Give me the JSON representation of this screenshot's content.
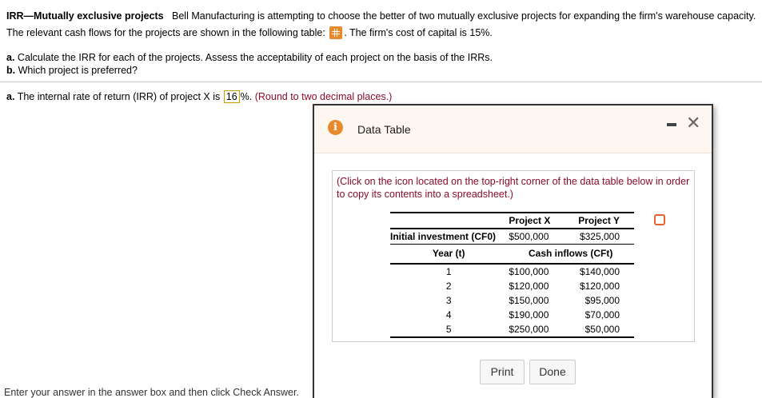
{
  "question": {
    "title": "IRR—Mutually exclusive projects",
    "text1": "Bell Manufacturing is attempting to choose the better of two mutually exclusive projects for expanding the firm's warehouse capacity. The relevant cash flows for the projects are shown in the following table:",
    "text2": ". The firm's cost of capital is 15%.",
    "part_a_label": "a.",
    "part_a": "Calculate the IRR for each of the projects. Assess the acceptability of each project on the basis of the IRRs.",
    "part_b_label": "b.",
    "part_b": "Which project is preferred?"
  },
  "answer": {
    "label": "a.",
    "text": "The internal rate of return (IRR) of project X is",
    "value": "16",
    "suffix": "%.",
    "hint": "(Round to two decimal places.)"
  },
  "footer_text": "Enter your answer in the answer box and then click Check Answer.",
  "dialog": {
    "title": "Data Table",
    "note": "(Click on the icon located on the top-right corner of the data table below in order to copy its contents into a spreadsheet.)",
    "headers": [
      "Project X",
      "Project Y"
    ],
    "initial_label": "Initial investment (CF0)",
    "initial": [
      "$500,000",
      "$325,000"
    ],
    "year_label": "Year (t)",
    "cash_label": "Cash inflows (CFt)",
    "rows": [
      {
        "year": "1",
        "x": "$100,000",
        "y": "$140,000"
      },
      {
        "year": "2",
        "x": "$120,000",
        "y": "$120,000"
      },
      {
        "year": "3",
        "x": "$150,000",
        "y": "$95,000"
      },
      {
        "year": "4",
        "x": "$190,000",
        "y": "$70,000"
      },
      {
        "year": "5",
        "x": "$250,000",
        "y": "$50,000"
      }
    ],
    "print_label": "Print",
    "done_label": "Done"
  }
}
